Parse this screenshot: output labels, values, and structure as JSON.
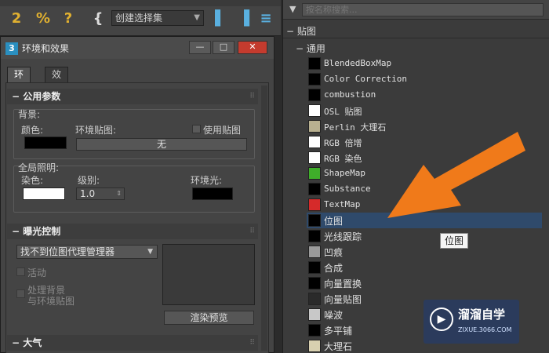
{
  "toolbar": {
    "selection_set_placeholder": "创建选择集",
    "icons": [
      "snap-2-5-icon",
      "percent-snap-icon",
      "spinner-snap-icon",
      "edit-named-selection-icon",
      "mirror-icon",
      "align-icon"
    ]
  },
  "dialog": {
    "title": "环境和效果",
    "app_icon_text": "3",
    "tabs": [
      {
        "label": "环境"
      },
      {
        "label": "效果"
      }
    ],
    "common_params": {
      "header": "公用参数",
      "background_label": "背景:",
      "color_label": "颜色:",
      "env_map_label": "环境贴图:",
      "use_map_label": "使用贴图",
      "env_map_button": "无",
      "global_lighting_label": "全局照明:",
      "tint_label": "染色:",
      "level_label": "级别:",
      "level_value": "1.0",
      "ambient_label": "环境光:",
      "bg_color": "#000000",
      "tint_color": "#ffffff",
      "ambient_color": "#000000"
    },
    "exposure": {
      "header": "曝光控制",
      "dropdown_value": "找不到位图代理管理器",
      "active_label": "活动",
      "process_bg_label": "处理背景\n与环境贴图",
      "render_preview_button": "渲染预览"
    },
    "atmosphere": {
      "header": "大气"
    }
  },
  "browser": {
    "search_placeholder": "按名称搜索...",
    "group_label": "贴图",
    "subgroup_label": "通用",
    "selected_index": 10,
    "items": [
      {
        "label": "BlendedBoxMap",
        "icon": "#000000",
        "mono": true
      },
      {
        "label": "Color Correction",
        "icon": "#000000",
        "mono": true
      },
      {
        "label": "combustion",
        "icon": "#000000",
        "mono": true
      },
      {
        "label": "OSL 贴图",
        "icon": "#ffffff",
        "mono": true
      },
      {
        "label": "Perlin 大理石",
        "icon": "#b8b090",
        "mono": true
      },
      {
        "label": "RGB 倍增",
        "icon": "#ffffff",
        "mono": true
      },
      {
        "label": "RGB 染色",
        "icon": "#ffffff",
        "mono": true
      },
      {
        "label": "ShapeMap",
        "icon": "#3fae2a",
        "mono": true
      },
      {
        "label": "Substance",
        "icon": "#000000",
        "mono": true
      },
      {
        "label": "TextMap",
        "icon": "#d62a2a",
        "mono": true
      },
      {
        "label": "位图",
        "icon": "#000000",
        "mono": false
      },
      {
        "label": "光线跟踪",
        "icon": "#000000",
        "mono": false
      },
      {
        "label": "凹痕",
        "icon": "#9a9a9a",
        "mono": false
      },
      {
        "label": "合成",
        "icon": "#000000",
        "mono": false
      },
      {
        "label": "向量置换",
        "icon": "#000000",
        "mono": false
      },
      {
        "label": "向量贴图",
        "icon": "#2a2a2a",
        "mono": false
      },
      {
        "label": "噪波",
        "icon": "#c8c8c8",
        "mono": false
      },
      {
        "label": "多平铺",
        "icon": "#000000",
        "mono": false
      },
      {
        "label": "大理石",
        "icon": "#d8d0b0",
        "mono": false
      }
    ],
    "tooltip": "位图"
  },
  "watermark": {
    "name": "溜溜自学",
    "url": "ZIXUE.3066.COM"
  },
  "colors": {
    "accent_arrow": "#f07a1a",
    "selection": "#2f4a6b"
  }
}
